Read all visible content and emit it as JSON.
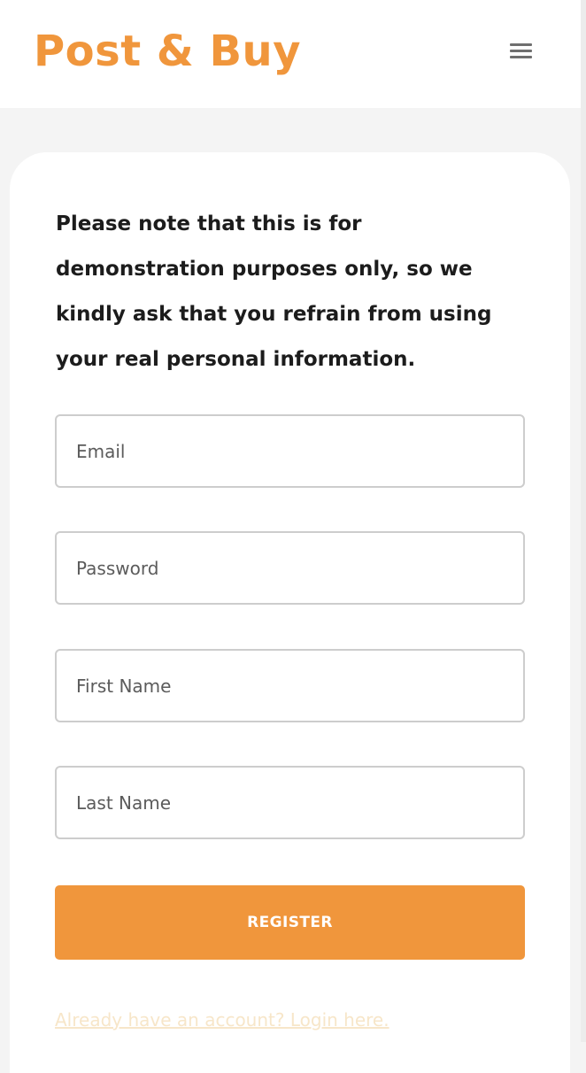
{
  "brand": {
    "name": "Post & Buy",
    "color": "#f0963c"
  },
  "header": {
    "menu_icon": "hamburger-menu-icon"
  },
  "form": {
    "notice": "Please note that this is for demonstration purposes only, so we kindly ask that you refrain from using your real personal information.",
    "fields": {
      "email": {
        "placeholder": "Email",
        "value": ""
      },
      "password": {
        "placeholder": "Password",
        "value": ""
      },
      "first_name": {
        "placeholder": "First Name",
        "value": ""
      },
      "last_name": {
        "placeholder": "Last Name",
        "value": ""
      }
    },
    "register_label": "REGISTER",
    "login_link": "Already have an account? Login here."
  },
  "colors": {
    "accent": "#f0963c",
    "page_background": "#f4f4f4",
    "card_background": "#ffffff",
    "text": "#1c1c1c",
    "link_faded": "#f7e6c9"
  }
}
